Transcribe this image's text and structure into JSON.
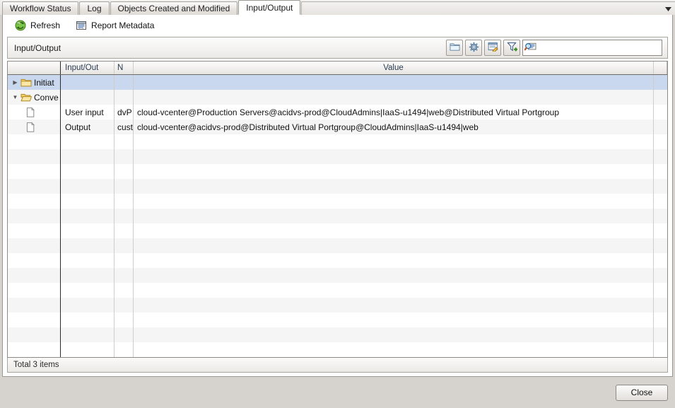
{
  "window": {
    "tabs": [
      {
        "label": "Workflow Status",
        "active": false
      },
      {
        "label": "Log",
        "active": false
      },
      {
        "label": "Objects Created and Modified",
        "active": false
      },
      {
        "label": "Input/Output",
        "active": true
      }
    ],
    "tab_overflow_icon": "chevron-down-icon"
  },
  "toolbar": {
    "refresh_label": "Refresh",
    "refresh_icon": "refresh-icon",
    "report_metadata_label": "Report Metadata",
    "report_metadata_icon": "report-icon"
  },
  "filterbar": {
    "title": "Input/Output",
    "buttons": [
      {
        "name": "folder-icon",
        "tip": "folder"
      },
      {
        "name": "gear-icon",
        "tip": "settings"
      },
      {
        "name": "edit-document-icon",
        "tip": "edit"
      },
      {
        "name": "filter-add-icon",
        "tip": "add filter"
      }
    ],
    "search": {
      "icon": "search-list-icon",
      "value": "",
      "placeholder": ""
    }
  },
  "table": {
    "columns": [
      {
        "key": "tree",
        "label": ""
      },
      {
        "key": "io",
        "label": "Input/Out"
      },
      {
        "key": "name",
        "label": "N"
      },
      {
        "key": "value",
        "label": "Value",
        "align": "center"
      },
      {
        "key": "tail",
        "label": ""
      }
    ],
    "rows": [
      {
        "type": "group",
        "expanded": false,
        "selected": true,
        "icon": "folder-closed-icon",
        "twisty": "▶",
        "label": "Initiat",
        "io": "",
        "name": "",
        "value": ""
      },
      {
        "type": "group",
        "expanded": true,
        "selected": false,
        "icon": "folder-open-icon",
        "twisty": "▼",
        "label": "Conve",
        "io": "",
        "name": "",
        "value": ""
      },
      {
        "type": "leaf",
        "selected": false,
        "icon": "document-icon",
        "label": "",
        "io": "User input",
        "name": "dvP",
        "value": "cloud-vcenter@Production Servers@acidvs-prod@CloudAdmins|IaaS-u1494|web@Distributed Virtual Portgroup"
      },
      {
        "type": "leaf",
        "selected": false,
        "icon": "document-icon",
        "label": "",
        "io": "Output",
        "name": "cust",
        "value": "cloud-vcenter@acidvs-prod@Distributed Virtual Portgroup@CloudAdmins|IaaS-u1494|web"
      }
    ],
    "empty_row_count": 15
  },
  "status": {
    "text": "Total 3 items"
  },
  "footer": {
    "close_label": "Close"
  },
  "colors": {
    "selection": "#c9d8ee",
    "header_text": "#2a3b52",
    "window_bg": "#d6d2ce",
    "accent_green": "#5aa832",
    "accent_blue": "#4a78b5"
  }
}
